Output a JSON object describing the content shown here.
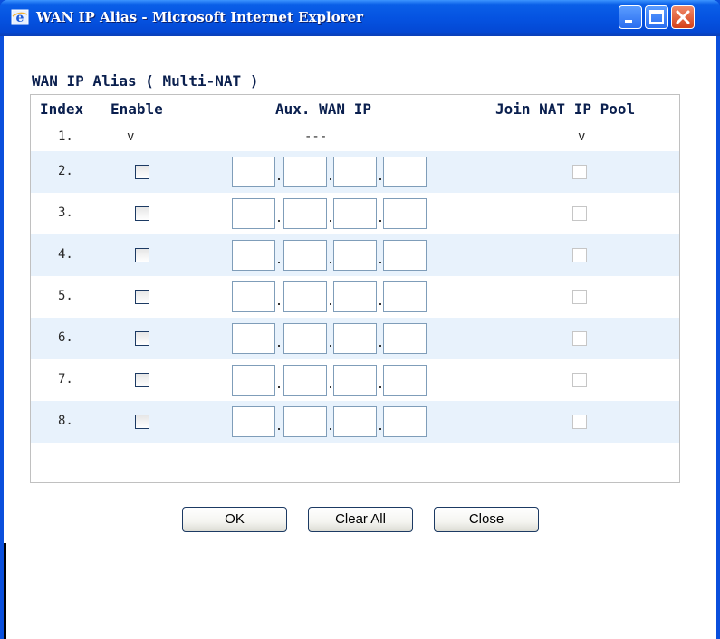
{
  "window": {
    "title": "WAN IP Alias - Microsoft Internet Explorer",
    "icon": "ie-icon",
    "controls": [
      "minimize-icon",
      "maximize-icon",
      "close-icon"
    ]
  },
  "section": {
    "title": "WAN IP Alias ( Multi-NAT )"
  },
  "table": {
    "headers": {
      "index": "Index",
      "enable": "Enable",
      "aux_ip": "Aux. WAN IP",
      "join_pool": "Join NAT IP Pool"
    },
    "first_row": {
      "index": "1.",
      "enable": "v",
      "aux_ip": "---",
      "join_pool": "v"
    },
    "rows": [
      {
        "index": "2.",
        "enable": false,
        "join_pool": false,
        "ip": [
          "",
          "",
          "",
          ""
        ]
      },
      {
        "index": "3.",
        "enable": false,
        "join_pool": false,
        "ip": [
          "",
          "",
          "",
          ""
        ]
      },
      {
        "index": "4.",
        "enable": false,
        "join_pool": false,
        "ip": [
          "",
          "",
          "",
          ""
        ]
      },
      {
        "index": "5.",
        "enable": false,
        "join_pool": false,
        "ip": [
          "",
          "",
          "",
          ""
        ]
      },
      {
        "index": "6.",
        "enable": false,
        "join_pool": false,
        "ip": [
          "",
          "",
          "",
          ""
        ]
      },
      {
        "index": "7.",
        "enable": false,
        "join_pool": false,
        "ip": [
          "",
          "",
          "",
          ""
        ]
      },
      {
        "index": "8.",
        "enable": false,
        "join_pool": false,
        "ip": [
          "",
          "",
          "",
          ""
        ]
      }
    ]
  },
  "buttons": {
    "ok": "OK",
    "clear_all": "Clear All",
    "close": "Close"
  },
  "colors": {
    "titlebar": "#0553e1",
    "row_alt": "#e8f2fc",
    "heading": "#0a1f4e"
  }
}
